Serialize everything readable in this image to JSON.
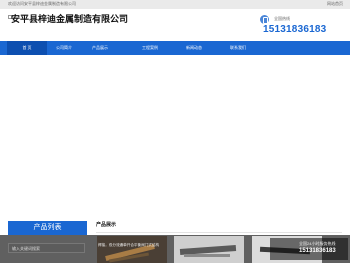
{
  "topbar": {
    "welcome": "欢迎访问安平县梓迪金属制造有限公司",
    "home_link": "网站首页"
  },
  "logo": {
    "company_name": "安平县梓迪金属制造有限公司"
  },
  "hotline": {
    "label": "全国热线",
    "number": "15131836183",
    "accent_color": "#1a67d2"
  },
  "nav": {
    "items": [
      {
        "label": "首 页",
        "active": true
      },
      {
        "label": "公司简介",
        "active": false
      },
      {
        "label": "产品展示",
        "active": false
      },
      {
        "label": "工程案例",
        "active": false
      },
      {
        "label": "新闻动态",
        "active": false
      },
      {
        "label": "联系我们",
        "active": false
      }
    ],
    "background_color": "#1a67d2"
  },
  "sidebar": {
    "heading": "产品列表"
  },
  "main": {
    "section_title": "产品展示"
  },
  "overlay": {
    "search_placeholder": "输入关键词搜索",
    "product_caption": "焊接，双分流通单开合平衡阀门式结构",
    "float_hotline_label": "全国24小时服务热线",
    "float_hotline_number": "15131836183"
  }
}
